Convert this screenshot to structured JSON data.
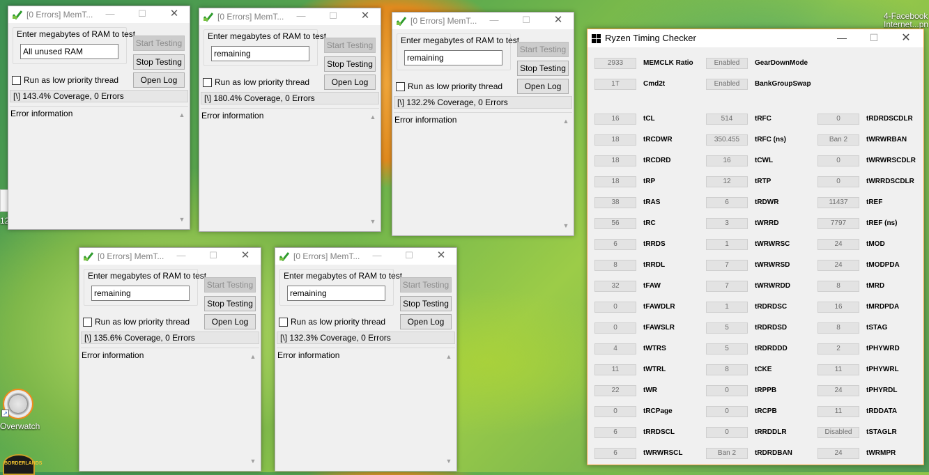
{
  "desktop": {
    "top_right_icon_label_1": "4-Facebook",
    "top_right_icon_label_2": "Internet...pn",
    "left_icon_fragment": "12",
    "overwatch_label": "Overwatch",
    "borderlands_logo_text": "BORDERLANDS"
  },
  "memtest_common": {
    "group_label": "Enter megabytes of RAM to test",
    "start_button": "Start Testing",
    "stop_button": "Stop Testing",
    "open_log_button": "Open Log",
    "low_priority_label": "Run as low priority thread",
    "error_info_label": "Error information",
    "minimize": "—",
    "maximize": "☐",
    "close": "✕",
    "scroll_up": "▲",
    "scroll_down": "▼"
  },
  "memtest_windows": [
    {
      "title": "[0 Errors] MemT...",
      "ram_value": "All unused RAM",
      "status": "[\\]   143.4% Coverage, 0 Errors"
    },
    {
      "title": "[0 Errors] MemT...",
      "ram_value": "remaining",
      "status": "[\\]   180.4% Coverage, 0 Errors"
    },
    {
      "title": "[0 Errors] MemT...",
      "ram_value": "remaining",
      "status": "[\\]   132.2% Coverage, 0 Errors"
    },
    {
      "title": "[0 Errors] MemT...",
      "ram_value": "remaining",
      "status": "[\\]   135.6% Coverage, 0 Errors"
    },
    {
      "title": "[0 Errors] MemT...",
      "ram_value": "remaining",
      "status": "[\\]   132.3% Coverage, 0 Errors"
    }
  ],
  "rtc": {
    "title": "Ryzen Timing Checker",
    "minimize": "—",
    "maximize": "☐",
    "close": "✕",
    "header_rows": [
      {
        "v1": "2933",
        "n1": "MEMCLK Ratio",
        "v2": "Enabled",
        "n2": "GearDownMode"
      },
      {
        "v1": "1T",
        "n1": "Cmd2t",
        "v2": "Enabled",
        "n2": "BankGroupSwap"
      }
    ],
    "rows": [
      {
        "v1": "16",
        "n1": "tCL",
        "v2": "514",
        "n2": "tRFC",
        "v3": "0",
        "n3": "tRDRDSCDLR"
      },
      {
        "v1": "18",
        "n1": "tRCDWR",
        "v2": "350.455",
        "n2": "tRFC (ns)",
        "v3": "Ban 2",
        "n3": "tWRWRBAN"
      },
      {
        "v1": "18",
        "n1": "tRCDRD",
        "v2": "16",
        "n2": "tCWL",
        "v3": "0",
        "n3": "tWRWRSCDLR"
      },
      {
        "v1": "18",
        "n1": "tRP",
        "v2": "12",
        "n2": "tRTP",
        "v3": "0",
        "n3": "tWRRDSCDLR"
      },
      {
        "v1": "38",
        "n1": "tRAS",
        "v2": "6",
        "n2": "tRDWR",
        "v3": "11437",
        "n3": "tREF"
      },
      {
        "v1": "56",
        "n1": "tRC",
        "v2": "3",
        "n2": "tWRRD",
        "v3": "7797",
        "n3": "tREF (ns)"
      },
      {
        "v1": "6",
        "n1": "tRRDS",
        "v2": "1",
        "n2": "tWRWRSC",
        "v3": "24",
        "n3": "tMOD"
      },
      {
        "v1": "8",
        "n1": "tRRDL",
        "v2": "7",
        "n2": "tWRWRSD",
        "v3": "24",
        "n3": "tMODPDA"
      },
      {
        "v1": "32",
        "n1": "tFAW",
        "v2": "7",
        "n2": "tWRWRDD",
        "v3": "8",
        "n3": "tMRD"
      },
      {
        "v1": "0",
        "n1": "tFAWDLR",
        "v2": "1",
        "n2": "tRDRDSC",
        "v3": "16",
        "n3": "tMRDPDA"
      },
      {
        "v1": "0",
        "n1": "tFAWSLR",
        "v2": "5",
        "n2": "tRDRDSD",
        "v3": "8",
        "n3": "tSTAG"
      },
      {
        "v1": "4",
        "n1": "tWTRS",
        "v2": "5",
        "n2": "tRDRDDD",
        "v3": "2",
        "n3": "tPHYWRD"
      },
      {
        "v1": "11",
        "n1": "tWTRL",
        "v2": "8",
        "n2": "tCKE",
        "v3": "11",
        "n3": "tPHYWRL"
      },
      {
        "v1": "22",
        "n1": "tWR",
        "v2": "0",
        "n2": "tRPPB",
        "v3": "24",
        "n3": "tPHYRDL"
      },
      {
        "v1": "0",
        "n1": "tRCPage",
        "v2": "0",
        "n2": "tRCPB",
        "v3": "11",
        "n3": "tRDDATA"
      },
      {
        "v1": "6",
        "n1": "tRRDSCL",
        "v2": "0",
        "n2": "tRRDDLR",
        "v3": "Disabled",
        "n3": "tSTAGLR"
      },
      {
        "v1": "6",
        "n1": "tWRWRSCL",
        "v2": "Ban 2",
        "n2": "tRDRDBAN",
        "v3": "24",
        "n3": "tWRMPR"
      }
    ]
  }
}
